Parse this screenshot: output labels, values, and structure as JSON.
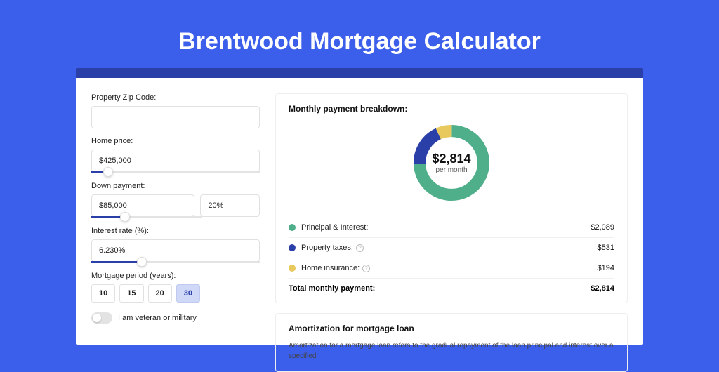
{
  "title": "Brentwood Mortgage Calculator",
  "form": {
    "zip_label": "Property Zip Code:",
    "zip_value": "",
    "home_price_label": "Home price:",
    "home_price_value": "$425,000",
    "down_payment_label": "Down payment:",
    "down_payment_value": "$85,000",
    "down_payment_pct": "20%",
    "interest_label": "Interest rate (%):",
    "interest_value": "6.230%",
    "period_label": "Mortgage period (years):",
    "periods": [
      "10",
      "15",
      "20",
      "30"
    ],
    "period_selected": "30",
    "veteran_label": "I am veteran or military"
  },
  "breakdown": {
    "title": "Monthly payment breakdown:",
    "center_amount": "$2,814",
    "center_sub": "per month",
    "items": [
      {
        "color": "green",
        "label": "Principal & Interest:",
        "value": "$2,089",
        "help": false
      },
      {
        "color": "blue",
        "label": "Property taxes:",
        "value": "$531",
        "help": true
      },
      {
        "color": "yellow",
        "label": "Home insurance:",
        "value": "$194",
        "help": true
      }
    ],
    "total_label": "Total monthly payment:",
    "total_value": "$2,814"
  },
  "amortization": {
    "title": "Amortization for mortgage loan",
    "text": "Amortization for a mortgage loan refers to the gradual repayment of the loan principal and interest over a specified"
  },
  "chart_data": {
    "type": "pie",
    "title": "Monthly payment breakdown",
    "series": [
      {
        "name": "Principal & Interest",
        "value": 2089,
        "color": "#4FAF8A"
      },
      {
        "name": "Property taxes",
        "value": 531,
        "color": "#2B3FA8"
      },
      {
        "name": "Home insurance",
        "value": 194,
        "color": "#E8C95E"
      }
    ],
    "total": 2814,
    "center_label": "$2,814 per month"
  }
}
